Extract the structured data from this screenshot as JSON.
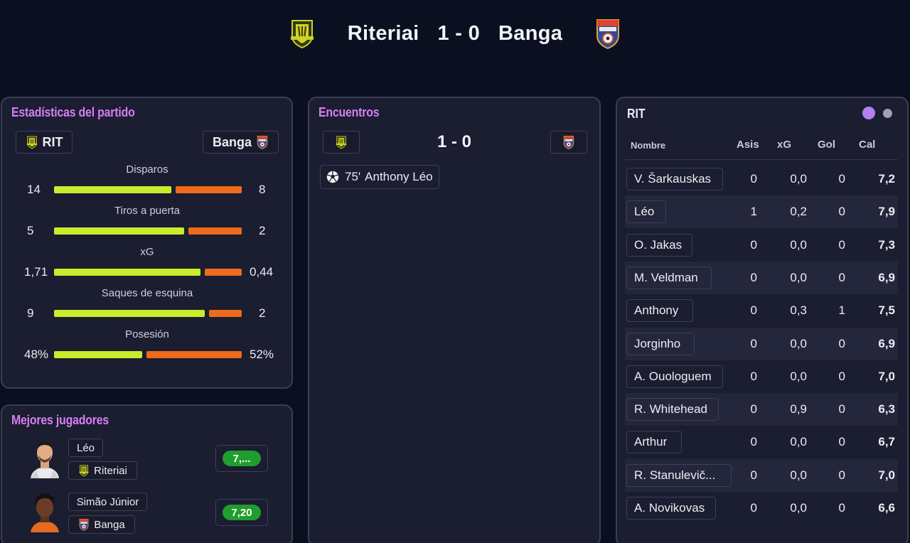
{
  "header": {
    "home_team": "Riteriai",
    "away_team": "Banga",
    "score": "1 - 0"
  },
  "colors": {
    "home_bar": "#c9ec2b",
    "away_bar": "#ee6a1c",
    "title_accent": "#d67ff2",
    "rating_green": "#1f9e2d"
  },
  "stats": {
    "title": "Estadísticas del partido",
    "home_chip": "RIT",
    "away_chip": "Banga",
    "rows": [
      {
        "label": "Disparos",
        "home": "14",
        "away": "8",
        "home_share": 0.64
      },
      {
        "label": "Tiros a puerta",
        "home": "5",
        "away": "2",
        "home_share": 0.71
      },
      {
        "label": "xG",
        "home": "1,71",
        "away": "0,44",
        "home_share": 0.8
      },
      {
        "label": "Saques de esquina",
        "home": "9",
        "away": "2",
        "home_share": 0.82
      },
      {
        "label": "Posesión",
        "home": "48%",
        "away": "52%",
        "home_share": 0.48
      }
    ]
  },
  "encounters": {
    "title": "Encuentros",
    "score": "1 - 0",
    "events": [
      {
        "icon": "soccer-ball-icon",
        "minute": "75'",
        "text": "Anthony Léo"
      }
    ]
  },
  "best_players": {
    "title": "Mejores jugadores",
    "players": [
      {
        "name": "Léo",
        "team": "Riteriai",
        "rating": "7,..."
      },
      {
        "name": "Simão Júnior",
        "team": "Banga",
        "rating": "7,20"
      }
    ]
  },
  "lineup": {
    "team_label": "RIT",
    "columns": [
      "Nombre",
      "Asis",
      "xG",
      "Gol",
      "Cal"
    ],
    "rows": [
      {
        "name": "V. Šarkauskas",
        "asis": "0",
        "xg": "0,0",
        "gol": "0",
        "cal": "7,2"
      },
      {
        "name": "Léo",
        "asis": "1",
        "xg": "0,2",
        "gol": "0",
        "cal": "7,9"
      },
      {
        "name": "O. Jakas",
        "asis": "0",
        "xg": "0,0",
        "gol": "0",
        "cal": "7,3"
      },
      {
        "name": "M. Veldman",
        "asis": "0",
        "xg": "0,0",
        "gol": "0",
        "cal": "6,9"
      },
      {
        "name": "Anthony",
        "asis": "0",
        "xg": "0,3",
        "gol": "1",
        "cal": "7,5"
      },
      {
        "name": "Jorginho",
        "asis": "0",
        "xg": "0,0",
        "gol": "0",
        "cal": "6,9"
      },
      {
        "name": "A. Ouologuem",
        "asis": "0",
        "xg": "0,0",
        "gol": "0",
        "cal": "7,0"
      },
      {
        "name": "R. Whitehead",
        "asis": "0",
        "xg": "0,9",
        "gol": "0",
        "cal": "6,3"
      },
      {
        "name": "Arthur",
        "asis": "0",
        "xg": "0,0",
        "gol": "0",
        "cal": "6,7"
      },
      {
        "name": "R. Stanulevič...",
        "asis": "0",
        "xg": "0,0",
        "gol": "0",
        "cal": "7,0"
      },
      {
        "name": "A. Novikovas",
        "asis": "0",
        "xg": "0,0",
        "gol": "0",
        "cal": "6,6"
      }
    ]
  }
}
